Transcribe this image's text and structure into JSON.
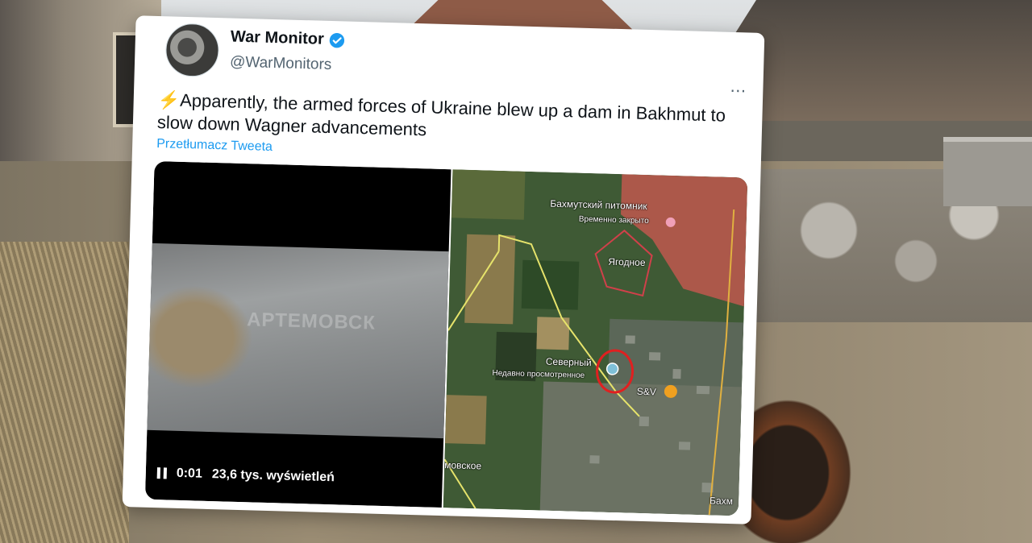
{
  "tweet": {
    "display_name": "War Monitor",
    "handle": "@WarMonitors",
    "more_icon": "⋯",
    "body_emoji": "⚡",
    "body_text": "Apparently, the armed forces of Ukraine blew up a dam in Bakhmut to slow down Wagner advancements",
    "translate_label": "Przetłumacz Tweeta"
  },
  "video": {
    "watermark": "АРТЕМОВСК",
    "time": "0:01",
    "views": "23,6 tys. wyświetleń"
  },
  "map": {
    "labels": {
      "nursery": "Бахмутский питомник",
      "temp_closed": "Временно закрыто",
      "yagodnoe": "Ягодное",
      "severny": "Северный",
      "recent": "Недавно просмотренное",
      "sv": "S&V",
      "movskoe": "мовское",
      "bakh": "Бахм"
    },
    "colors": {
      "occupied": "#c0584e",
      "frontline": "#e6e36b",
      "circle": "#e02020"
    }
  }
}
